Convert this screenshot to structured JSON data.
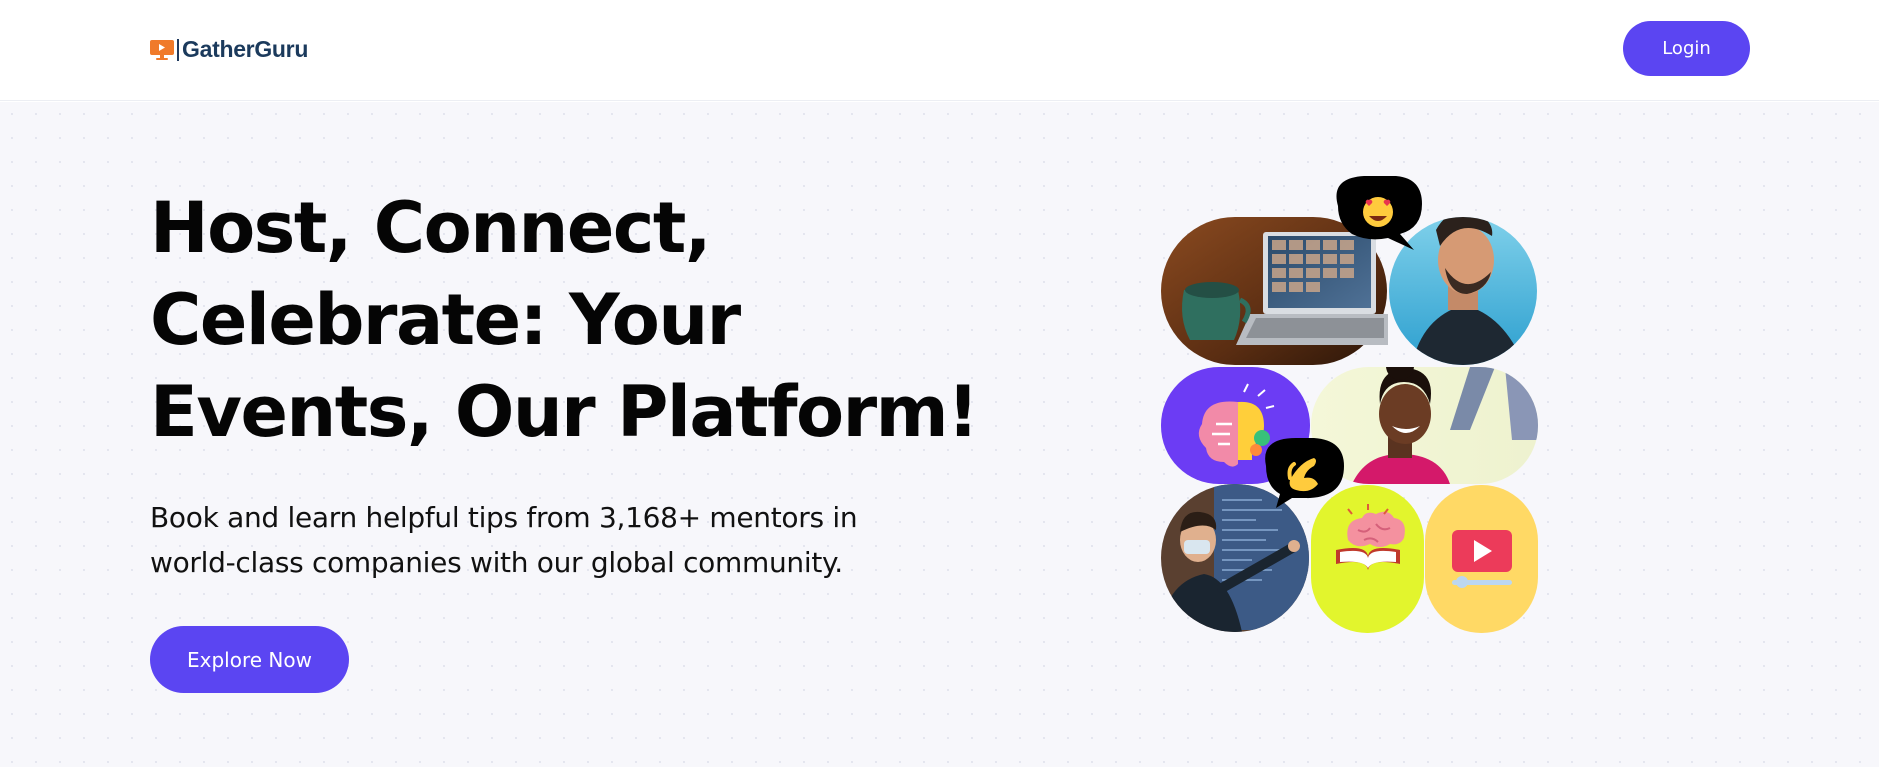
{
  "brand": {
    "name": "GatherGuru",
    "icon": "monitor-play-icon",
    "accent": "#f07a2a",
    "text_color": "#1b3a5c"
  },
  "nav": {
    "login_label": "Login"
  },
  "hero": {
    "headline": [
      "Host, Connect,",
      "Celebrate: Your",
      "Events, Our Platform!"
    ],
    "subtext": [
      "Book and learn helpful tips from 3,168+ mentors in",
      "world-class companies with our global community."
    ],
    "cta_label": "Explore Now"
  },
  "collage": {
    "tiles": [
      {
        "name": "laptop-video-call-photo"
      },
      {
        "name": "smiling-man-photo"
      },
      {
        "name": "brain-lightbulb-illustration"
      },
      {
        "name": "smiling-woman-photo"
      },
      {
        "name": "presenter-screen-photo"
      },
      {
        "name": "brain-book-illustration"
      },
      {
        "name": "video-player-illustration"
      }
    ],
    "bubbles": [
      {
        "name": "heart-eyes-emoji-bubble",
        "emoji": "😍"
      },
      {
        "name": "clap-emoji-bubble",
        "emoji": "🤌"
      }
    ]
  },
  "colors": {
    "primary": "#5b45f2",
    "hero_bg": "#f7f7fb",
    "lime": "#e2f52d",
    "yellow": "#ffd965",
    "purple": "#6c3cf4"
  }
}
